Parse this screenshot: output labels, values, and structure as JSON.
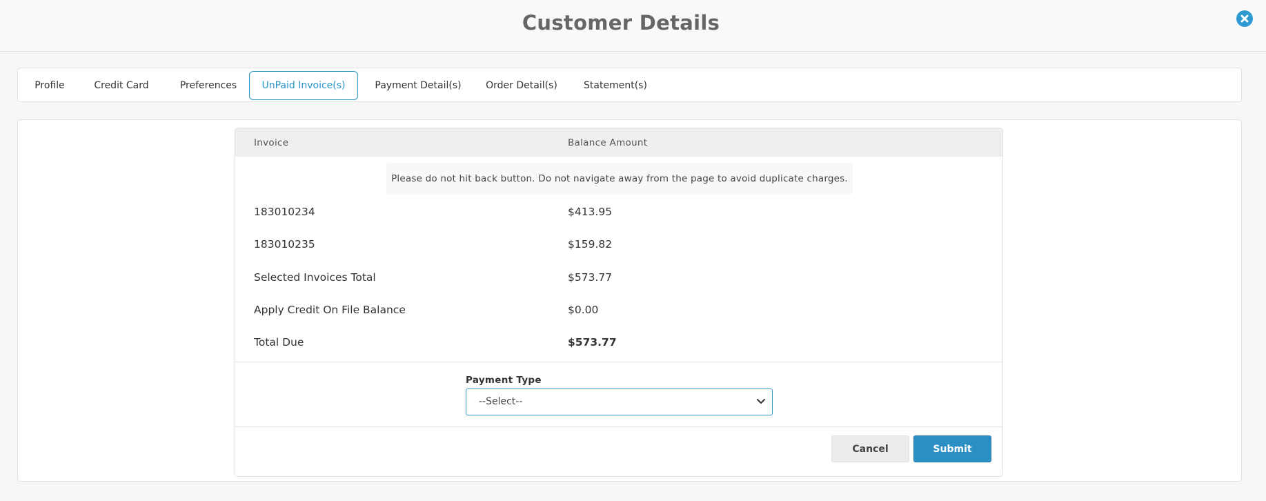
{
  "header": {
    "title": "Customer Details",
    "close_icon": "close-icon"
  },
  "tabs": [
    {
      "label": "Profile"
    },
    {
      "label": "Credit Card"
    },
    {
      "label": "Preferences"
    },
    {
      "label": "UnPaid Invoice(s)",
      "active": true
    },
    {
      "label": "Payment Detail(s)"
    },
    {
      "label": "Order Detail(s)"
    },
    {
      "label": "Statement(s)"
    }
  ],
  "table": {
    "columns": [
      "Invoice",
      "Balance Amount"
    ],
    "notice": "Please do not hit back button. Do not navigate away from the page to avoid duplicate charges.",
    "rows": [
      {
        "label": "183010234",
        "amount": "$413.95"
      },
      {
        "label": "183010235",
        "amount": "$159.82"
      },
      {
        "label": "Selected Invoices Total",
        "amount": "$573.77"
      },
      {
        "label": "Apply Credit On File Balance",
        "amount": "$0.00"
      },
      {
        "label": "Total Due",
        "amount": "$573.77"
      }
    ]
  },
  "payment": {
    "label": "Payment Type",
    "selected": "--Select--"
  },
  "actions": {
    "cancel_label": "Cancel",
    "submit_label": "Submit"
  },
  "colors": {
    "accent": "#2a96c9",
    "submit": "#2b8fc4"
  }
}
